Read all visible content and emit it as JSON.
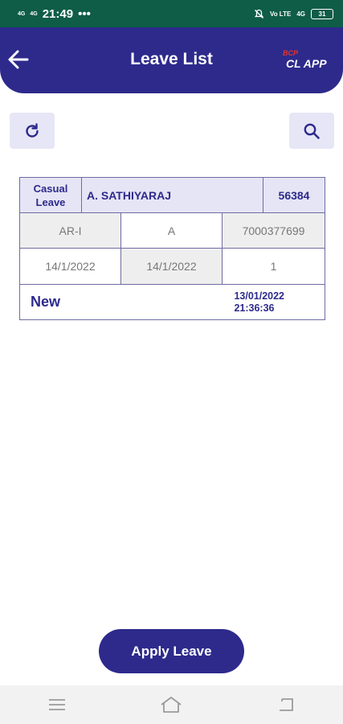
{
  "status_bar": {
    "net_left_1": "4G",
    "net_left_2": "4G",
    "time": "21:49",
    "dots": "•••",
    "volte": "Vo LTE",
    "net_right": "4G",
    "battery": "31"
  },
  "header": {
    "title": "Leave List",
    "logo_top": "BCP",
    "logo_main": "CL APP"
  },
  "icons": {
    "back": "arrow-left-icon",
    "refresh": "refresh-icon",
    "search": "search-icon"
  },
  "leave_card": {
    "leave_type_line1": "Casual",
    "leave_type_line2": "Leave",
    "employee_name": "A. SATHIYARAJ",
    "employee_id": "56384",
    "unit": "AR-I",
    "shift": "A",
    "phone": "7000377699",
    "from_date": "14/1/2022",
    "to_date": "14/1/2022",
    "days": "1",
    "status": "New",
    "applied_date": "13/01/2022",
    "applied_time": "21:36:36"
  },
  "apply_button": {
    "label": "Apply Leave"
  },
  "colors": {
    "primary": "#2d2a8c",
    "status_bar": "#0f5d47",
    "cell_highlight": "#e6e5f5",
    "logo_accent": "#e5332a"
  }
}
